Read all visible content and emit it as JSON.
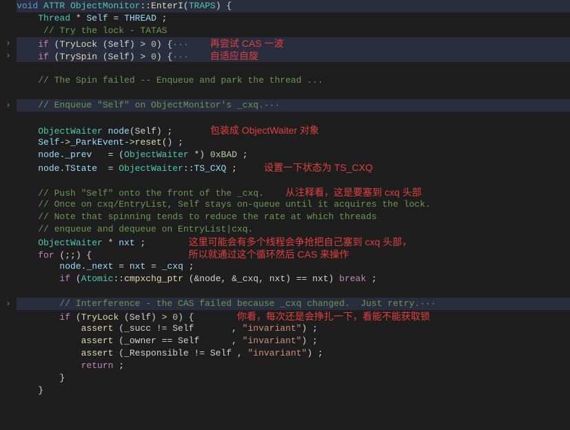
{
  "code": {
    "l1_void": "void",
    "l1_attr": "ATTR",
    "l1_class": "ObjectMonitor",
    "l1_method": "EnterI",
    "l1_param_type": "TRAPS",
    "l1_brace": "{",
    "l2_type": "Thread",
    "l2_star": " * ",
    "l2_self": "Self",
    "l2_eq": " = ",
    "l2_thread": "THREAD",
    "l2_semi": " ;",
    "l3_cmt": " // Try the lock - TATAS",
    "l4_if": "if",
    "l4_open": " (",
    "l4_try": "TryLock",
    "l4_args": " (Self) > ",
    "l4_zero": "0",
    "l4_close": ") {",
    "l4_dots": "···",
    "a1": "再尝试 CAS 一波",
    "l5_if": "if",
    "l5_open": " (",
    "l5_try": "TrySpin",
    "l5_args": " (Self) > ",
    "l5_zero": "0",
    "l5_close": ") {",
    "l5_dots": "···",
    "a2": "自适应自旋",
    "l7_cmt": "// The Spin failed -- Enqueue and park the thread ...",
    "l9_cmt": "// Enqueue \"Self\" on ObjectMonitor's _cxq.",
    "l9_dots": "···",
    "l11_type": "ObjectWaiter",
    "l11_var": " node",
    "l11_args": "(Self) ;",
    "a3": "包装成 ObjectWaiter 对象",
    "l12_self": "Self",
    "l12_arrow": "->",
    "l12_park": "_ParkEvent",
    "l12_arrow2": "->",
    "l12_reset": "reset",
    "l12_tail": "() ;",
    "l13_node": "node",
    "l13_dot": ".",
    "l13_prev": "_prev",
    "l13_sp": "   = (",
    "l13_type": "ObjectWaiter",
    "l13_cast": " *) ",
    "l13_hex": "0xBAD",
    "l13_semi": " ;",
    "l14_node": "node",
    "l14_dot": ".",
    "l14_tstate": "TState",
    "l14_sp": "  = ",
    "l14_type": "ObjectWaiter",
    "l14_scope": "::",
    "l14_tscxq": "TS_CXQ",
    "l14_semi": " ;",
    "a4": "设置一下状态为 TS_CXQ",
    "l16_cmt": "// Push \"Self\" onto the front of the _cxq.",
    "a5": "从注释看，这是要塞到 cxq 头部",
    "l17_cmt": "// Once on cxq/EntryList, Self stays on-queue until it acquires the lock.",
    "l18_cmt": "// Note that spinning tends to reduce the rate at which threads",
    "l19_cmt": "// enqueue and dequeue on EntryList|cxq.",
    "l20_type": "ObjectWaiter",
    "l20_star": " * ",
    "l20_nxt": "nxt",
    "l20_semi": " ;",
    "a6": "这里可能会有多个线程会争抢把自己塞到 cxq 头部，",
    "l21_for": "for",
    "l21_cond": " (;;) {",
    "a7": "所以就通过这个循环然后 CAS 来操作",
    "l22_node": "node",
    "l22_dot": ".",
    "l22_next": "_next",
    "l22_eq": " = ",
    "l22_nxt": "nxt",
    "l22_eq2": " = ",
    "l22_cxq": "_cxq",
    "l22_semi": " ;",
    "l23_if": "if",
    "l23_open": " (",
    "l23_atomic": "Atomic",
    "l23_scope": "::",
    "l23_cmp": "cmpxchg_ptr",
    "l23_args": " (&node, &_cxq, nxt) == nxt) ",
    "l23_break": "break",
    "l23_semi": " ;",
    "l25_cmt": "// Interference - the CAS failed because _cxq changed.  Just retry.",
    "l25_dots": "···",
    "l26_if": "if",
    "l26_open": " (",
    "l26_try": "TryLock",
    "l26_args": " (Self) > ",
    "l26_zero": "0",
    "l26_close": ") {",
    "a8": "你看，每次还是会挣扎一下，看能不能获取锁",
    "l27_assert": "assert",
    "l27_args": " (_succ != Self       , ",
    "l27_str": "\"invariant\"",
    "l27_tail": ") ;",
    "l28_assert": "assert",
    "l28_args": " (_owner == Self      , ",
    "l28_str": "\"invariant\"",
    "l28_tail": ") ;",
    "l29_assert": "assert",
    "l29_args": " (_Responsible != Self , ",
    "l29_str": "\"invariant\"",
    "l29_tail": ") ;",
    "l30_return": "return",
    "l30_semi": " ;",
    "l31_brace": "}",
    "l32_brace": "}"
  },
  "fold_chevron": "›"
}
